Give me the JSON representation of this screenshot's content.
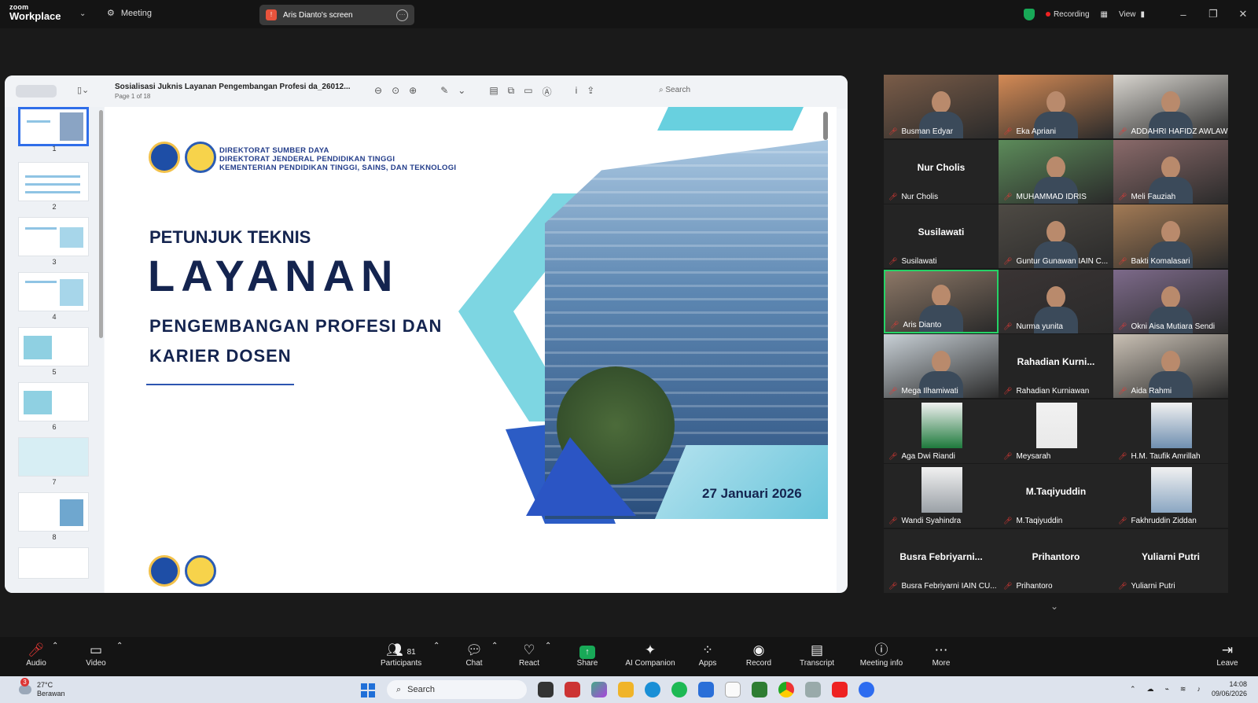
{
  "app": {
    "brand_line1": "zoom",
    "brand_line2": "Workplace",
    "meeting_tab": "Meeting",
    "screen_share_label": "Aris Dianto's screen",
    "recording_label": "Recording",
    "view_label": "View"
  },
  "viewer": {
    "doc_title": "Sosialisasi Juknis Layanan Pengembangan Profesi da_26012...",
    "page_indicator": "Page 1 of 18",
    "search_placeholder": "Search",
    "thumb_numbers": [
      "1",
      "2",
      "3",
      "4",
      "5",
      "6",
      "7",
      "8"
    ]
  },
  "slide": {
    "org_line1": "DIREKTORAT SUMBER DAYA",
    "org_line2": "DIREKTORAT JENDERAL PENDIDIKAN TINGGI",
    "org_line3": "KEMENTERIAN PENDIDIKAN TINGGI, SAINS, DAN TEKNOLOGI",
    "title_small": "PETUNJUK TEKNIS",
    "title_big": "LAYANAN",
    "subtitle_1": "PENGEMBANGAN PROFESI DAN",
    "subtitle_2": "KARIER DOSEN",
    "date": "27 Januari 2026"
  },
  "participants": [
    {
      "name": "Busman Edyar",
      "video": true,
      "color": "#7a5c48"
    },
    {
      "name": "Eka Apriani",
      "video": true,
      "color": "#d48a55"
    },
    {
      "name": "ADDAHRI HAFIDZ AWLAWI",
      "video": true,
      "color": "#d8d5cf"
    },
    {
      "name": "Nur Cholis",
      "display": "Nur Cholis",
      "video": false
    },
    {
      "name": "MUHAMMAD IDRIS",
      "video": true,
      "color": "#5c8b5a"
    },
    {
      "name": "Meli Fauziah",
      "video": true,
      "color": "#8a6a6a"
    },
    {
      "name": "Susilawati",
      "display": "Susilawati",
      "video": false
    },
    {
      "name": "Guntur Gunawan IAIN C...",
      "video": true,
      "color": "#4e4a44"
    },
    {
      "name": "Bakti Komalasari",
      "video": true,
      "color": "#a27a55"
    },
    {
      "name": "Aris Dianto",
      "video": true,
      "color": "#8c7766",
      "active": true
    },
    {
      "name": "Nurma yunita",
      "video": true,
      "color": "#3a3434"
    },
    {
      "name": "Okni Aisa Mutiara Sendi",
      "video": true,
      "color": "#7d6a8a"
    },
    {
      "name": "Mega Ilhamiwati",
      "video": true,
      "color": "#c8d0d6"
    },
    {
      "name": "Rahadian Kurniawan",
      "display": "Rahadian Kurni...",
      "video": false
    },
    {
      "name": "Aida Rahmi",
      "video": true,
      "color": "#c9c0b4"
    },
    {
      "name": "Aga Dwi Riandi",
      "portrait": true,
      "color": "#1e7a3c"
    },
    {
      "name": "Meysarah",
      "portrait": true,
      "color": "#e9e9e9"
    },
    {
      "name": "H.M. Taufik Amrillah",
      "portrait": true,
      "color": "#6f8fb0"
    },
    {
      "name": "Wandi Syahindra",
      "portrait": true,
      "color": "#9aa0a6"
    },
    {
      "name": "M.Taqiyuddin",
      "display": "M.Taqiyuddin",
      "video": false
    },
    {
      "name": "Fakhruddin Ziddan",
      "portrait": true,
      "color": "#8aa6c2"
    },
    {
      "name": "Busra Febriyarni IAIN CU...",
      "display": "Busra  Febriyarni...",
      "video": false
    },
    {
      "name": "Prihantoro",
      "display": "Prihantoro",
      "video": false
    },
    {
      "name": "Yuliarni Putri",
      "display": "Yuliarni Putri",
      "video": false
    }
  ],
  "controls": {
    "audio": "Audio",
    "video": "Video",
    "participants": "Participants",
    "participants_count": "81",
    "chat": "Chat",
    "react": "React",
    "share": "Share",
    "ai_companion": "AI Companion",
    "apps": "Apps",
    "record": "Record",
    "transcript": "Transcript",
    "meeting_info": "Meeting info",
    "more": "More",
    "leave": "Leave"
  },
  "taskbar": {
    "notification_count": "3",
    "temperature": "27°C",
    "weather": "Berawan",
    "search": "Search",
    "time": "14:08",
    "date": "09/06/2026"
  },
  "colors": {
    "accent_green": "#18a957",
    "active_speaker": "#25d366",
    "muted_red": "#e53935",
    "slide_navy": "#14244f"
  }
}
